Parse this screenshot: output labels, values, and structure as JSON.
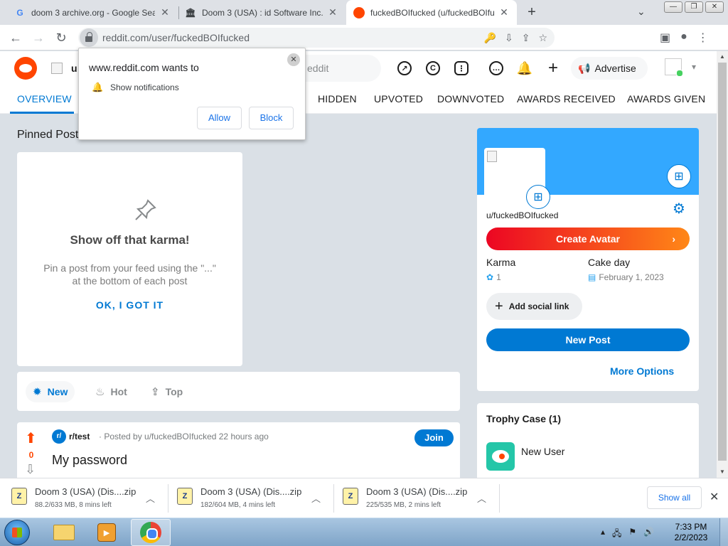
{
  "browser": {
    "tabs": [
      {
        "title": "doom 3 archive.org - Google Sea",
        "favicon": "G"
      },
      {
        "title": "Doom 3 (USA) : id Software Inc. :",
        "favicon": "archive-icon"
      },
      {
        "title": "fuckedBOIfucked (u/fuckedBOIfu",
        "favicon": "reddit-icon"
      }
    ],
    "url": "reddit.com/user/fuckedBOIfucked"
  },
  "notification_popup": {
    "site": "www.reddit.com wants to",
    "permission": "Show notifications",
    "allow_label": "Allow",
    "block_label": "Block"
  },
  "reddit": {
    "search_placeholder": "eddit",
    "header_username": "u",
    "advertise_label": "Advertise",
    "profile_tabs": [
      "OVERVIEW",
      "HIDDEN",
      "UPVOTED",
      "DOWNVOTED",
      "AWARDS RECEIVED",
      "AWARDS GIVEN"
    ],
    "pinned_title": "Pinned Post",
    "karma_card": {
      "heading": "Show off that karma!",
      "body": "Pin a post from your feed using the \"...\" at the bottom of each post",
      "action": "OK, I GOT IT"
    },
    "sort": [
      "New",
      "Hot",
      "Top"
    ],
    "post": {
      "score": "0",
      "subreddit": "r/test",
      "meta": "· Posted by u/fuckedBOIfucked 22 hours ago",
      "join_label": "Join",
      "title": "My password"
    },
    "profile_card": {
      "username": "u/fuckedBOIfucked",
      "create_avatar": "Create Avatar",
      "karma_label": "Karma",
      "karma_value": "1",
      "cakeday_label": "Cake day",
      "cakeday_value": "February 1, 2023",
      "social_link": "Add social link",
      "new_post": "New Post",
      "more_options": "More Options"
    },
    "trophy_case": {
      "title": "Trophy Case (1)",
      "trophy": "New User"
    },
    "colors": {
      "accent": "#0079d3",
      "brand": "#ff4500",
      "banner": "#33a8ff"
    }
  },
  "downloads": {
    "items": [
      {
        "name": "Doom 3 (USA) (Dis....zip",
        "status": "88.2/633 MB, 8 mins left"
      },
      {
        "name": "Doom 3 (USA) (Dis....zip",
        "status": "182/604 MB, 4 mins left"
      },
      {
        "name": "Doom 3 (USA) (Dis....zip",
        "status": "225/535 MB, 2 mins left"
      }
    ],
    "show_all": "Show all"
  },
  "taskbar": {
    "time": "7:33 PM",
    "date": "2/2/2023"
  }
}
